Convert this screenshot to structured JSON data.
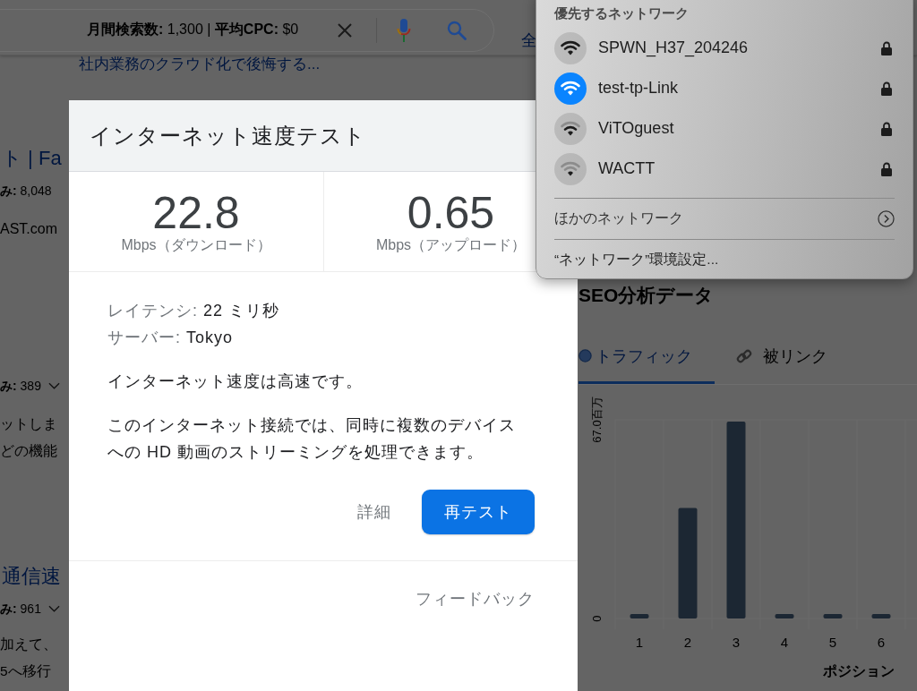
{
  "search_bar": {
    "keyword_stats": "**月間検索数:** 1,300 | **平均CPC:** $0",
    "nav_tab": "全"
  },
  "top_result_link": "社内業務のクラウド化で後悔する...",
  "results": [
    {
      "title": "ト | Fa",
      "stats": "**み:** 8,048",
      "stats_dropdown": false,
      "url": "AST.com"
    },
    {
      "stats": "**み:** 389",
      "stats_dropdown": true,
      "snippet_lines": [
        "ットしま",
        "どの機能"
      ]
    },
    {
      "title": "通信速",
      "stats": "**み:** 961",
      "stats_dropdown": true,
      "snippet_lines": [
        "加えて、",
        "5へ移行"
      ]
    }
  ],
  "dialog": {
    "title": "インターネット速度テスト",
    "metrics": [
      {
        "value": "22.8",
        "unit": "Mbps（ダウンロード）"
      },
      {
        "value": "0.65",
        "unit": "Mbps（アップロード）"
      }
    ],
    "details": [
      {
        "label": "レイテンシ:",
        "value": "22 ミリ秒"
      },
      {
        "label": "サーバー:",
        "value": "Tokyo"
      }
    ],
    "summary": "インターネット速度は高速です。",
    "description": "このインターネット接続では、同時に複数のデバイスへの HD 動画のストリーミングを処理できます。",
    "buttons": [
      {
        "label": "詳細",
        "kind": "text"
      },
      {
        "label": "再テスト",
        "kind": "primary"
      }
    ],
    "feedback": "フィードバック"
  },
  "seo_panel": {
    "title": "SEO分析データ",
    "tabs": [
      {
        "label": "トラフィック",
        "kind": "traffic",
        "selected": true
      },
      {
        "label": "被リンク",
        "kind": "backlinks",
        "selected": false
      }
    ],
    "chart_data": {
      "type": "bar",
      "xlabel": "ポジション",
      "categories": [
        "1",
        "2",
        "3",
        "4",
        "5",
        "6"
      ],
      "series": [
        {
          "color": "#1c2733",
          "values": [
            1.5,
            37.3,
            66.4,
            1.5,
            1.5,
            1.5
          ]
        }
      ],
      "ylim": [
        0,
        67
      ],
      "yticks": [
        {
          "value": 0,
          "label": "0"
        },
        {
          "value": 67,
          "label": "67.0百万"
        }
      ]
    }
  },
  "wifi_menu": {
    "section_title": "優先するネットワーク",
    "networks": [
      {
        "name": "SPWN_H37_204246",
        "selected": false,
        "kind": "strong",
        "locked": true
      },
      {
        "name": "test-tp-Link",
        "selected": true,
        "kind": "strong",
        "locked": true
      },
      {
        "name": "ViTOguest",
        "selected": false,
        "kind": "medium",
        "locked": true
      },
      {
        "name": "WACTT",
        "selected": false,
        "kind": "weak",
        "locked": true
      }
    ],
    "other_networks": "ほかのネットワーク",
    "preferences": "“ネットワーク”環境設定..."
  }
}
